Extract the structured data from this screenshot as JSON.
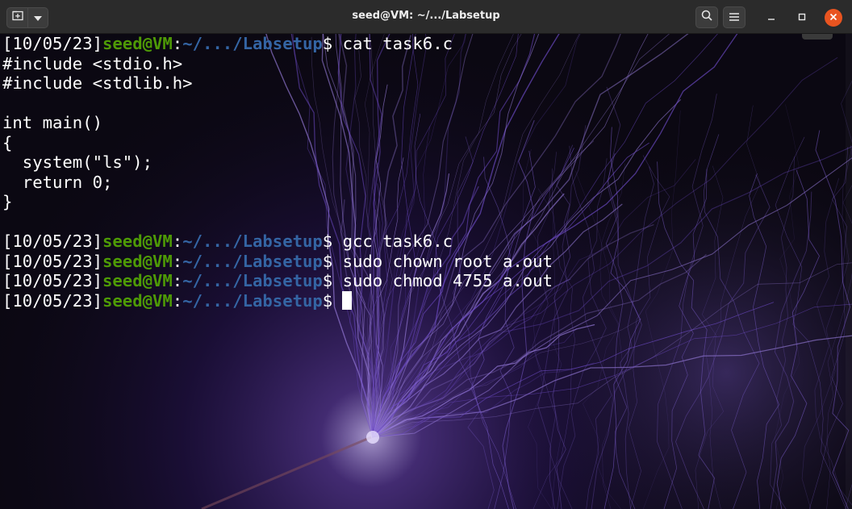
{
  "window": {
    "title": "seed@VM: ~/.../Labsetup"
  },
  "icons": {
    "new_tab": "new-tab-icon",
    "dropdown": "chevron-down-icon",
    "search": "search-icon",
    "menu": "hamburger-menu-icon",
    "minimize": "minimize-icon",
    "maximize": "maximize-icon",
    "close": "close-icon"
  },
  "colors": {
    "prompt_user": "#4e9a06",
    "prompt_path": "#3465a4",
    "close_button": "#e95420",
    "titlebar": "#2b2b2b"
  },
  "terminal": {
    "prompt": {
      "date": "[10/05/23]",
      "user": "seed@VM",
      "colon": ":",
      "path": "~/.../Labsetup",
      "dollar": "$"
    },
    "lines": [
      {
        "type": "prompt",
        "command": " cat task6.c"
      },
      {
        "type": "output",
        "text": "#include <stdio.h>"
      },
      {
        "type": "output",
        "text": "#include <stdlib.h>"
      },
      {
        "type": "output",
        "text": ""
      },
      {
        "type": "output",
        "text": "int main()"
      },
      {
        "type": "output",
        "text": "{"
      },
      {
        "type": "output",
        "text": "  system(\"ls\");"
      },
      {
        "type": "output",
        "text": "  return 0;"
      },
      {
        "type": "output",
        "text": "}"
      },
      {
        "type": "output",
        "text": ""
      },
      {
        "type": "prompt",
        "command": " gcc task6.c"
      },
      {
        "type": "prompt",
        "command": " sudo chown root a.out"
      },
      {
        "type": "prompt",
        "command": " sudo chmod 4755 a.out"
      },
      {
        "type": "prompt",
        "command": "",
        "cursor": true
      }
    ]
  }
}
